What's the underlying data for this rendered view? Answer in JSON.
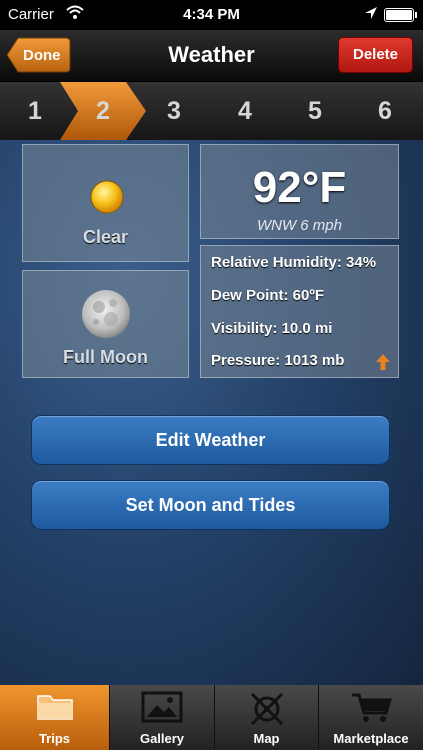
{
  "status_bar": {
    "carrier": "Carrier",
    "time": "4:34 PM"
  },
  "nav": {
    "title": "Weather",
    "done_label": "Done",
    "delete_label": "Delete"
  },
  "steps": [
    "1",
    "2",
    "3",
    "4",
    "5",
    "6"
  ],
  "active_step": "2",
  "weather": {
    "condition": "Clear",
    "moon_phase": "Full Moon",
    "temperature": "92°F",
    "wind": "WNW 6 mph",
    "humidity": "Relative Humidity: 34%",
    "dew_point": "Dew Point: 60ºF",
    "visibility": "Visibility: 10.0 mi",
    "pressure": "Pressure: 1013 mb"
  },
  "actions": {
    "edit_weather": "Edit Weather",
    "set_moon_tides": "Set Moon and Tides"
  },
  "tabs": [
    {
      "label": "Trips",
      "icon": "folder-icon"
    },
    {
      "label": "Gallery",
      "icon": "picture-icon"
    },
    {
      "label": "Map",
      "icon": "compass-icon"
    },
    {
      "label": "Marketplace",
      "icon": "cart-icon"
    }
  ],
  "active_tab": "Trips",
  "colors": {
    "accent_orange": "#d9761a",
    "delete_red": "#c8261c",
    "button_blue": "#2a6ab3"
  }
}
